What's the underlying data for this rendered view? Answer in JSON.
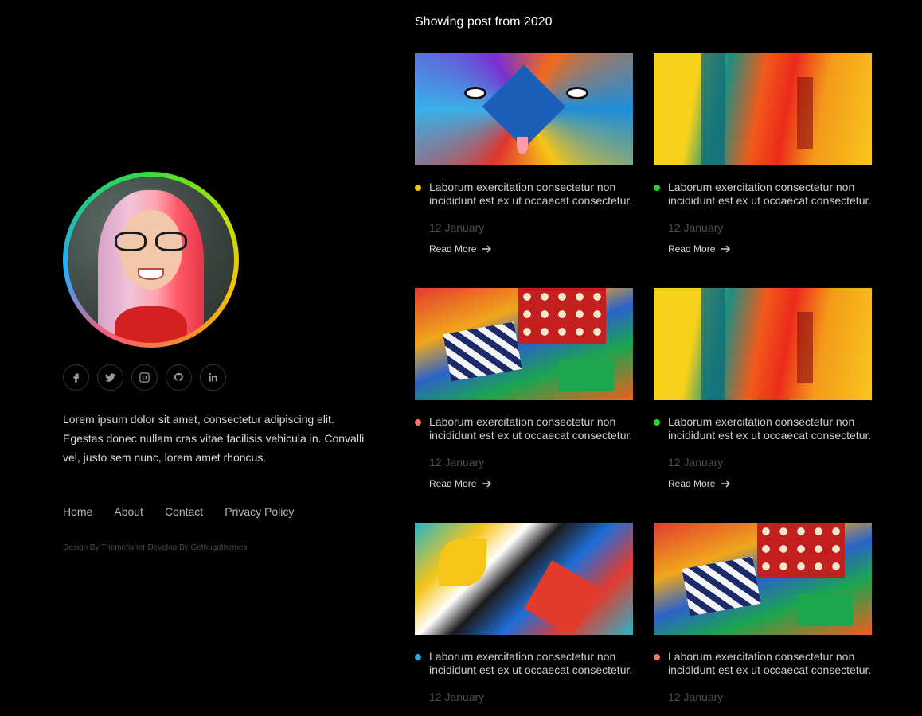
{
  "sidebar": {
    "bio": "Lorem ipsum dolor sit amet, consectetur adipiscing elit. Egestas donec nullam cras vitae facilisis vehicula in. Convalli vel, justo sem nunc, lorem amet rhoncus.",
    "social_icons": [
      "facebook-icon",
      "twitter-icon",
      "instagram-icon",
      "github-icon",
      "linkedin-icon"
    ],
    "footer_nav": [
      "Home",
      "About",
      "Contact",
      "Privacy Policy"
    ],
    "credits": "Design By Themefisher Develop By Gethugothemes"
  },
  "main": {
    "heading": "Showing post from 2020",
    "read_more_label": "Read More",
    "posts": [
      {
        "title": "Laborum exercitation consectetur non incididunt est ex ut occaecat consectetur.",
        "date": "12 January",
        "dot_color": "#f5c518",
        "art": "geometric-bear-mural"
      },
      {
        "title": "Laborum exercitation consectetur non incididunt est ex ut occaecat consectetur.",
        "date": "12 January",
        "dot_color": "#28d42c",
        "art": "abstract-paint-strokes"
      },
      {
        "title": "Laborum exercitation consectetur non incididunt est ex ut occaecat consectetur.",
        "date": "12 January",
        "dot_color": "#f07d5a",
        "art": "polka-dot-mural"
      },
      {
        "title": "Laborum exercitation consectetur non incididunt est ex ut occaecat consectetur.",
        "date": "12 January",
        "dot_color": "#28d42c",
        "art": "abstract-paint-strokes"
      },
      {
        "title": "Laborum exercitation consectetur non incididunt est ex ut occaecat consectetur.",
        "date": "12 January",
        "dot_color": "#2aa7e8",
        "art": "abstract-shapes-mural"
      },
      {
        "title": "Laborum exercitation consectetur non incididunt est ex ut occaecat consectetur.",
        "date": "12 January",
        "dot_color": "#f07d5a",
        "art": "polka-dot-mural"
      }
    ]
  }
}
